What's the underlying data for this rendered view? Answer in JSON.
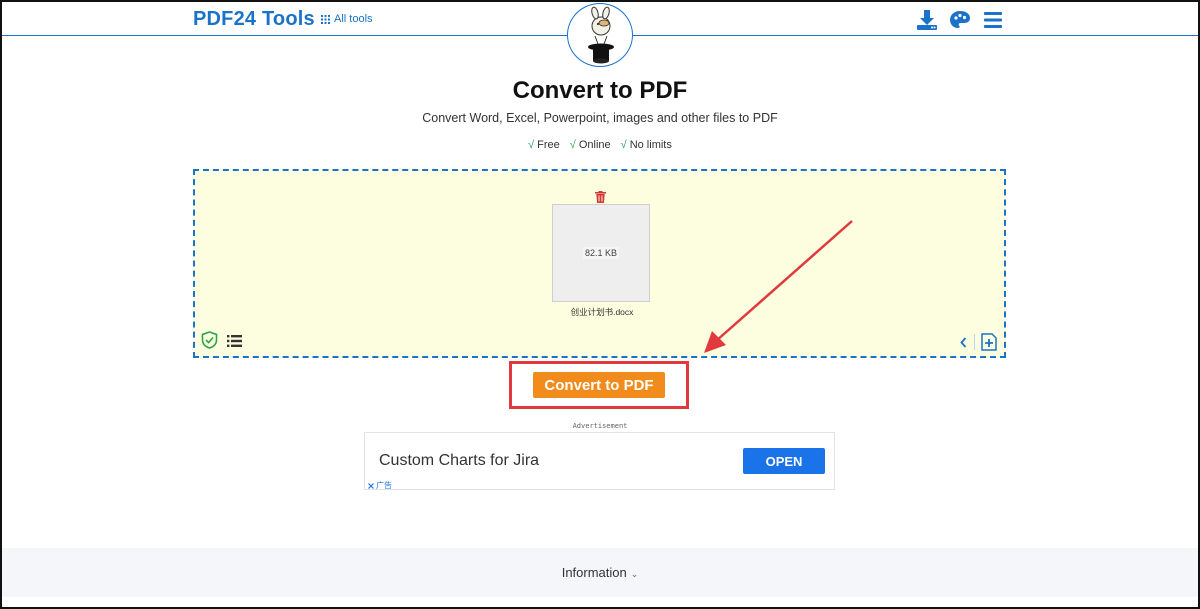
{
  "header": {
    "logo": "PDF24 Tools",
    "all_tools_label": "All tools",
    "icons": [
      "download-icon",
      "palette-icon",
      "hamburger-menu-icon"
    ],
    "mascot": "mascot-logo"
  },
  "main": {
    "title": "Convert to PDF",
    "subtitle": "Convert Word, Excel, Powerpoint, images and other files to PDF",
    "features": [
      {
        "check": "√",
        "label": "Free"
      },
      {
        "check": "√",
        "label": "Online"
      },
      {
        "check": "√",
        "label": "No limits"
      }
    ]
  },
  "dropzone": {
    "file": {
      "size": "82.1 KB",
      "name": "创业计划书.docx"
    },
    "background_color": "#fdfde0",
    "border_color": "#1a73c9"
  },
  "action": {
    "convert_label": "Convert to PDF",
    "button_color": "#f08b1c",
    "annotation_color": "#e0393e"
  },
  "ad": {
    "label": "Advertisement",
    "headline": "Custom Charts for Jira",
    "cta": "OPEN",
    "ad_marker": "广告"
  },
  "footer": {
    "info_label": "Information",
    "caret": "⌄"
  },
  "colors": {
    "brand_blue": "#1a73c9",
    "check_green": "#2ca34a"
  }
}
